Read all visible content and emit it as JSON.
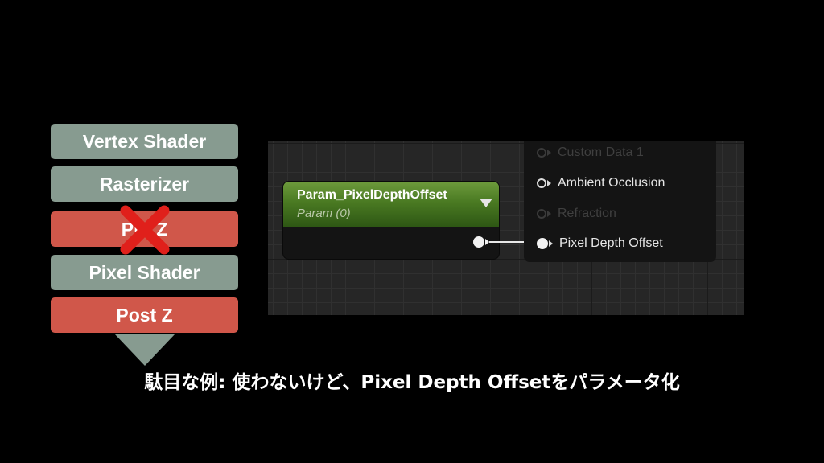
{
  "pipeline": {
    "stages": [
      {
        "label": "Vertex Shader",
        "color": "#879b90"
      },
      {
        "label": "Rasterizer",
        "color": "#879b90"
      },
      {
        "label": "Pre Z",
        "color": "#d0574a",
        "disabled": true
      },
      {
        "label": "Pixel Shader",
        "color": "#879b90"
      },
      {
        "label": "Post Z",
        "color": "#d0574a"
      }
    ],
    "disabled_marker": "cross-icon",
    "cross_color": "#e0201b"
  },
  "graph": {
    "param_node": {
      "title": "Param_PixelDepthOffset",
      "subtitle": "Param (0)",
      "header_color": "#4a7a22"
    },
    "material_inputs": [
      {
        "label": "Custom Data 1",
        "active": false
      },
      {
        "label": "Ambient Occlusion",
        "active": true
      },
      {
        "label": "Refraction",
        "active": false
      },
      {
        "label": "Pixel Depth Offset",
        "active": true,
        "connected": true
      }
    ]
  },
  "caption": "駄目な例: 使わないけど、Pixel Depth Offsetをパラメータ化"
}
